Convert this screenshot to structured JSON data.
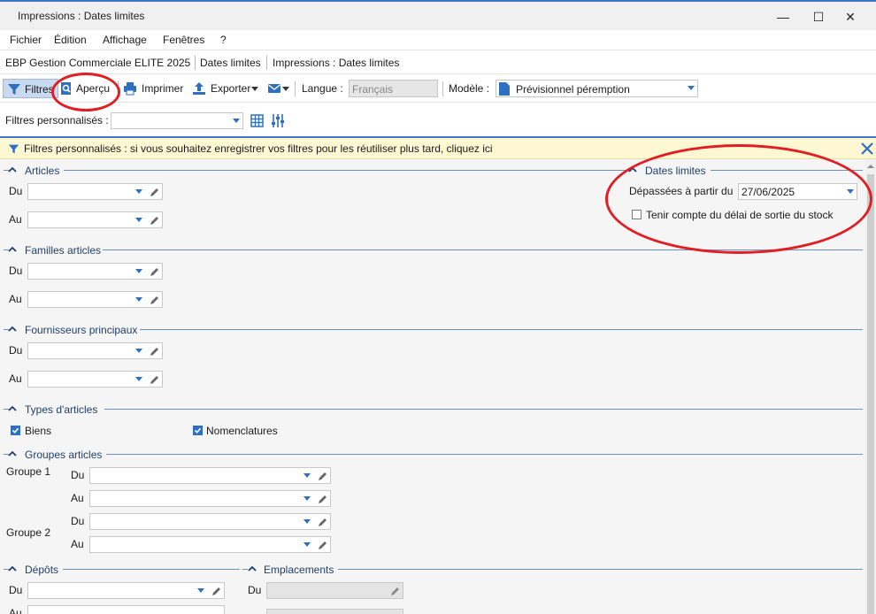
{
  "window": {
    "title": "Impressions : Dates limites",
    "minimize": "—",
    "maximize": "☐",
    "close": "✕"
  },
  "menu": {
    "items": [
      "Fichier",
      "Édition",
      "Affichage",
      "Fenêtres",
      "?"
    ]
  },
  "breadcrumb": {
    "items": [
      "EBP Gestion Commerciale ELITE 2025",
      "Dates limites",
      "Impressions : Dates limites"
    ]
  },
  "toolbar": {
    "filtres": "Filtres",
    "apercu": "Aperçu",
    "imprimer": "Imprimer",
    "exporter": "Exporter",
    "langue_label": "Langue :",
    "langue_value": "Français",
    "modele_label": "Modèle :",
    "modele_value": "Prévisionnel péremption"
  },
  "filters": {
    "label": "Filtres personnalisés :",
    "value": ""
  },
  "infobar": {
    "text": "Filtres personnalisés : si vous souhaitez enregistrer vos filtres pour les réutiliser plus tard, cliquez ici"
  },
  "sections": {
    "articles": {
      "title": "Articles",
      "du": "Du",
      "au": "Au"
    },
    "familles": {
      "title": "Familles articles",
      "du": "Du",
      "au": "Au"
    },
    "fournisseurs": {
      "title": "Fournisseurs principaux",
      "du": "Du",
      "au": "Au"
    },
    "types": {
      "title": "Types d'articles",
      "biens": "Biens",
      "biens_checked": true,
      "nomenclatures": "Nomenclatures",
      "nomenclatures_checked": true
    },
    "groupes": {
      "title": "Groupes articles",
      "groupe1": "Groupe 1",
      "groupe2": "Groupe 2",
      "du": "Du",
      "au": "Au"
    },
    "depots": {
      "title": "Dépôts",
      "du": "Du",
      "au": "Au"
    },
    "emplacements": {
      "title": "Emplacements",
      "du": "Du"
    },
    "dates": {
      "title": "Dates limites",
      "depassees_label": "Dépassées à partir du",
      "depassees_value": "27/06/2025",
      "tenir_compte": "Tenir compte du délai de sortie du stock",
      "tenir_compte_checked": false
    }
  },
  "colors": {
    "accent": "#2e6fc2",
    "annotation": "#e01e24",
    "info_bg": "#fdf7d2"
  }
}
